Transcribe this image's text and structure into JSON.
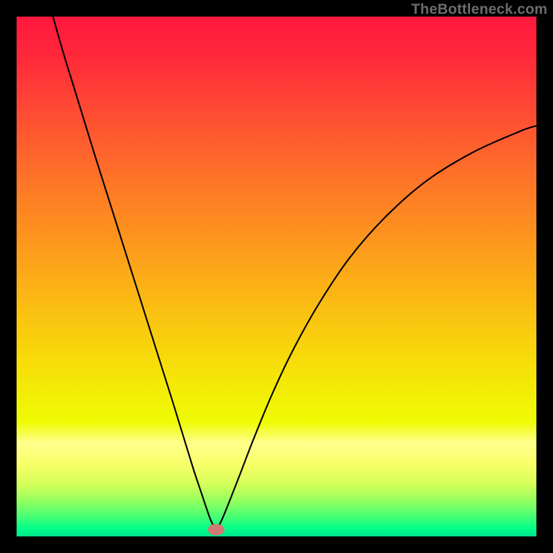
{
  "attribution": {
    "text": "TheBottleneck.com"
  },
  "chart_data": {
    "type": "line",
    "title": "",
    "xlabel": "",
    "ylabel": "",
    "xlim": [
      0,
      100
    ],
    "ylim": [
      0,
      100
    ],
    "grid": false,
    "legend": false,
    "background_gradient": {
      "stops": [
        {
          "pos": 0.0,
          "color": "#ff173e"
        },
        {
          "pos": 0.08,
          "color": "#ff2a3a"
        },
        {
          "pos": 0.18,
          "color": "#ff4a34"
        },
        {
          "pos": 0.3,
          "color": "#fe7029"
        },
        {
          "pos": 0.42,
          "color": "#fd931e"
        },
        {
          "pos": 0.55,
          "color": "#fbbb13"
        },
        {
          "pos": 0.68,
          "color": "#f6e108"
        },
        {
          "pos": 0.78,
          "color": "#effc03"
        },
        {
          "pos": 0.82,
          "color": "#ffff8c"
        },
        {
          "pos": 0.86,
          "color": "#f9ff6a"
        },
        {
          "pos": 0.9,
          "color": "#d4ff58"
        },
        {
          "pos": 0.93,
          "color": "#96ff5e"
        },
        {
          "pos": 0.96,
          "color": "#4cff72"
        },
        {
          "pos": 0.985,
          "color": "#00ff8a"
        },
        {
          "pos": 1.0,
          "color": "#00e38b"
        }
      ]
    },
    "series": [
      {
        "name": "left-branch",
        "color": "#000000",
        "width": 2.2,
        "x": [
          7.0,
          9.0,
          11.0,
          13.0,
          15.0,
          18.0,
          21.0,
          24.0,
          27.0,
          30.0,
          32.0,
          34.0,
          35.5,
          36.5,
          37.2,
          37.8,
          38.2
        ],
        "y": [
          100.0,
          93.0,
          86.5,
          80.0,
          73.5,
          64.0,
          54.5,
          45.0,
          35.5,
          26.0,
          19.5,
          13.0,
          8.5,
          5.5,
          3.5,
          2.2,
          1.5
        ]
      },
      {
        "name": "right-branch",
        "color": "#000000",
        "width": 2.2,
        "x": [
          38.6,
          39.2,
          40.0,
          41.2,
          43.0,
          45.5,
          49.0,
          53.0,
          58.0,
          64.0,
          71.0,
          79.0,
          88.0,
          97.0,
          100.0
        ],
        "y": [
          1.5,
          2.6,
          4.4,
          7.4,
          12.0,
          18.5,
          27.0,
          35.5,
          44.5,
          53.5,
          61.5,
          68.5,
          74.0,
          78.0,
          79.0
        ]
      }
    ],
    "marker": {
      "x": 38.4,
      "y": 1.3,
      "rx": 1.6,
      "ry": 1.1,
      "color": "#cf7a73"
    }
  }
}
